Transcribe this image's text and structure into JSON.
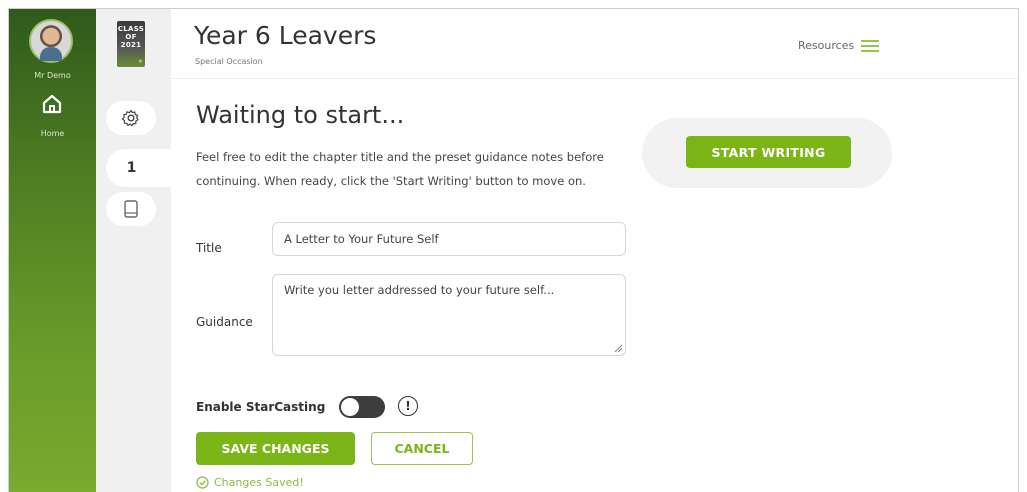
{
  "user": {
    "name": "Mr Demo"
  },
  "nav": {
    "home_label": "Home"
  },
  "book": {
    "cover_text": "CLASS OF 2021"
  },
  "chapters": [
    {
      "label": "1"
    }
  ],
  "header": {
    "title": "Year 6 Leavers",
    "subtitle": "Special Occasion",
    "resources_label": "Resources"
  },
  "main": {
    "status": "Waiting to start...",
    "help_text": "Feel free to edit the chapter title and the preset guidance notes before continuing. When ready, click the 'Start Writing' button to move on.",
    "start_button": "START WRITING",
    "title_label": "Title",
    "title_value": "A Letter to Your Future Self",
    "guidance_label": "Guidance",
    "guidance_value": "Write you letter addressed to your future self...",
    "starcasting_label": "Enable StarCasting",
    "starcasting_enabled": false,
    "info_glyph": "!",
    "save_button": "SAVE CHANGES",
    "cancel_button": "CANCEL",
    "saved_message": "Changes Saved!"
  },
  "colors": {
    "accent": "#7cb518",
    "rail_top": "#2f5a1c",
    "rail_bottom": "#7aaa2e"
  },
  "icons": [
    "home-icon",
    "gear-icon",
    "book-icon",
    "hamburger-icon",
    "info-icon",
    "check-circle-icon"
  ]
}
